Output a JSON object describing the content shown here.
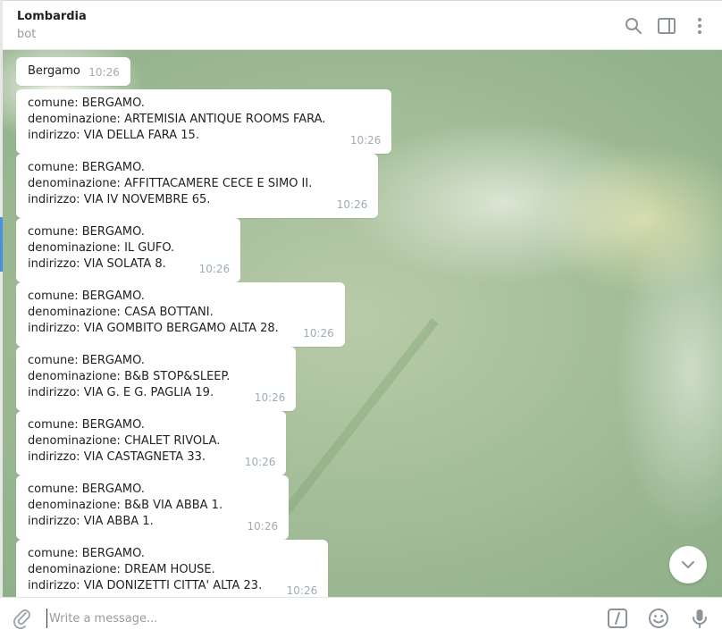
{
  "header": {
    "title": "Lombardia",
    "subtitle": "bot"
  },
  "icons": {
    "search": "search-icon",
    "sidebar": "sidebar-toggle-icon",
    "more": "more-vertical-icon",
    "attach": "paperclip-icon",
    "commands": "slash-command-icon",
    "emoji": "emoji-icon",
    "mic": "microphone-icon",
    "scroll": "chevron-down-icon"
  },
  "messages": [
    {
      "lines": [
        "Bergamo"
      ],
      "time": "10:26"
    },
    {
      "lines": [
        "comune: BERGAMO.",
        "denominazione: ARTEMISIA ANTIQUE ROOMS FARA.",
        "indirizzo: VIA DELLA FARA 15."
      ],
      "time": "10:26"
    },
    {
      "lines": [
        "comune: BERGAMO.",
        "denominazione: AFFITTACAMERE CECE E SIMO II.",
        "indirizzo: VIA IV NOVEMBRE 65."
      ],
      "time": "10:26"
    },
    {
      "lines": [
        "comune: BERGAMO.",
        "denominazione: IL GUFO.",
        "indirizzo: VIA SOLATA 8."
      ],
      "time": "10:26"
    },
    {
      "lines": [
        "comune: BERGAMO.",
        "denominazione: CASA BOTTANI.",
        "indirizzo: VIA GOMBITO BERGAMO ALTA 28."
      ],
      "time": "10:26"
    },
    {
      "lines": [
        "comune: BERGAMO.",
        "denominazione: B&B STOP&SLEEP.",
        "indirizzo: VIA G. E G. PAGLIA 19."
      ],
      "time": "10:26"
    },
    {
      "lines": [
        "comune: BERGAMO.",
        "denominazione: CHALET RIVOLA.",
        "indirizzo: VIA CASTAGNETA 33."
      ],
      "time": "10:26"
    },
    {
      "lines": [
        "comune: BERGAMO.",
        "denominazione: B&B VIA ABBA 1.",
        "indirizzo: VIA ABBA 1."
      ],
      "time": "10:26"
    },
    {
      "lines": [
        "comune: BERGAMO.",
        "denominazione: DREAM HOUSE.",
        "indirizzo: VIA DONIZETTI CITTA' ALTA 23."
      ],
      "time": "10:26"
    }
  ],
  "composer": {
    "placeholder": "Write a message...",
    "value": ""
  },
  "colors": {
    "accent": "#4a90e2",
    "time_text": "#a0acb6"
  }
}
